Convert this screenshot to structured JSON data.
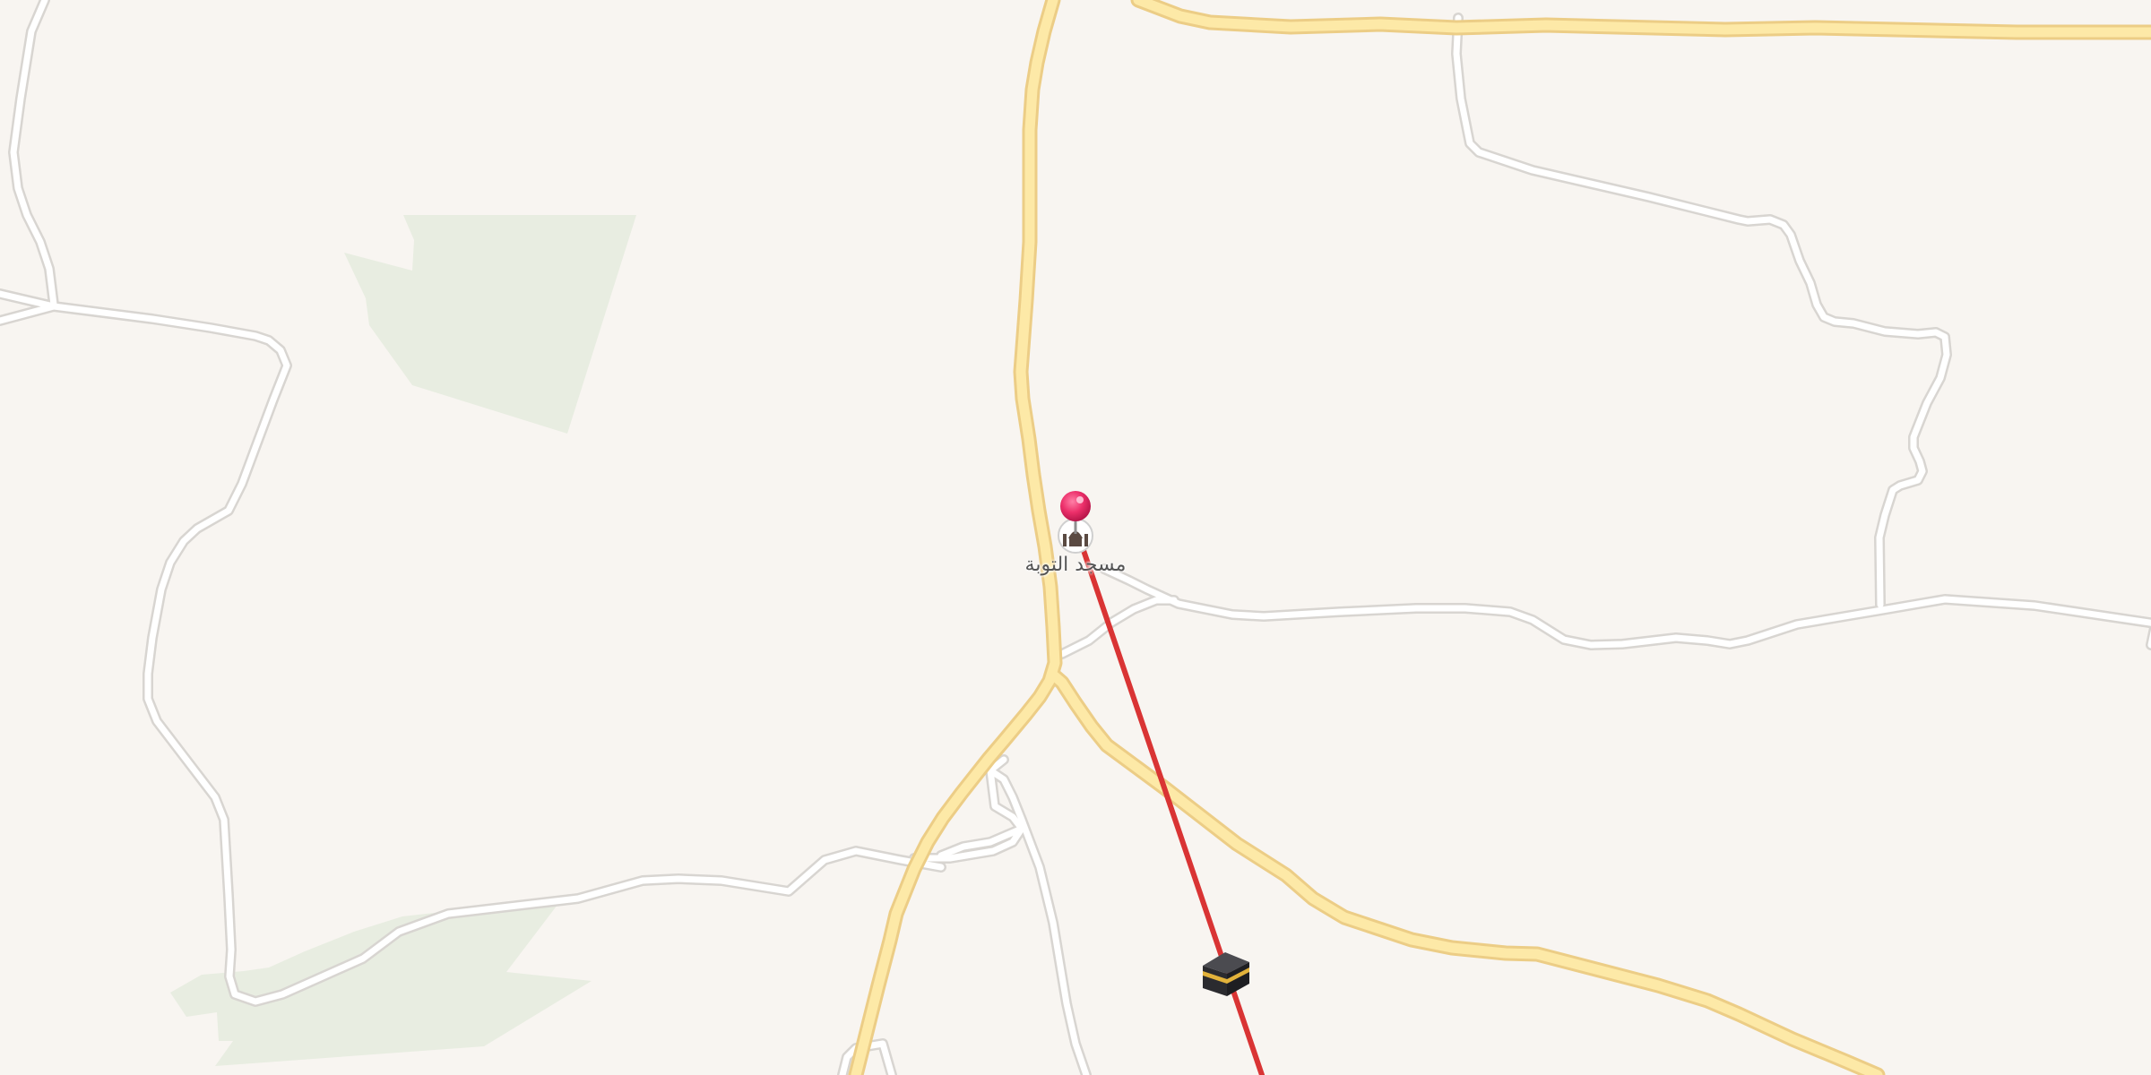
{
  "map": {
    "background_color": "#f8f5f1",
    "park_color": "#e8ede1",
    "major_road_fill": "#fde9a7",
    "major_road_casing": "#eccd86",
    "minor_road_fill": "#ffffff",
    "minor_road_casing": "#d8d5d1",
    "qibla_line_color": "#d93434"
  },
  "poi": {
    "name": "مسجد التوبة",
    "icon": "mosque-icon",
    "pin_color": "#ec2f6a"
  },
  "kaaba": {
    "icon": "kaaba-icon"
  }
}
